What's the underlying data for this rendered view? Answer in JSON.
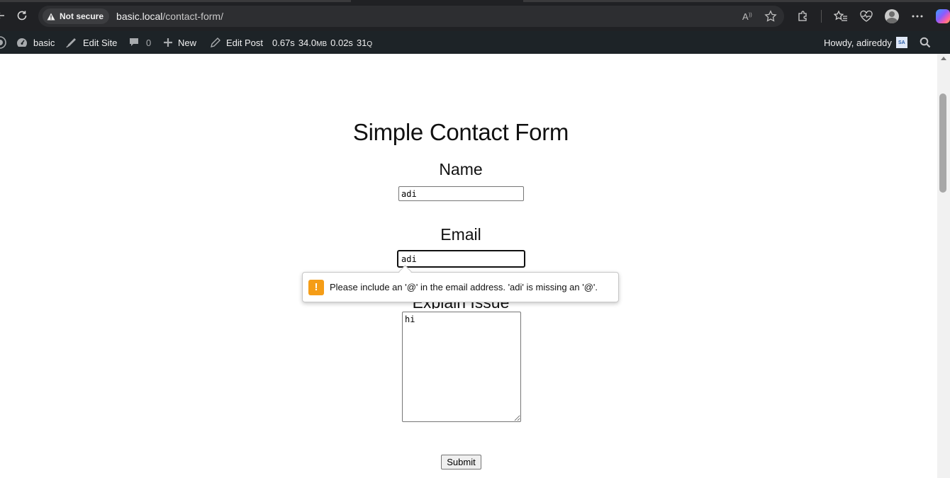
{
  "browser": {
    "security_label": "Not secure",
    "url_host": "basic.local",
    "url_path": "/contact-form/"
  },
  "admin_bar": {
    "site_name": "basic",
    "edit_site": "Edit Site",
    "comments_count": "0",
    "new_label": "New",
    "edit_post": "Edit Post",
    "stats": {
      "time": "0.67s",
      "memory_value": "34.0",
      "memory_unit": "MB",
      "query_time": "0.02s",
      "queries_value": "31",
      "queries_unit": "Q"
    },
    "howdy": "Howdy, adireddy",
    "avatar_initials": "SA"
  },
  "form": {
    "title": "Simple Contact Form",
    "name_label": "Name",
    "name_value": "adi",
    "email_label": "Email",
    "email_value": "adi",
    "issue_label": "Explain Issue",
    "issue_value": "hi",
    "submit_label": "Submit"
  },
  "validation": {
    "icon": "!",
    "message": "Please include an '@' in the email address. 'adi' is missing an '@'."
  },
  "colors": {
    "warning": "#f59d17",
    "admin_bar_bg": "#1d2327",
    "browser_bg": "#202124"
  }
}
